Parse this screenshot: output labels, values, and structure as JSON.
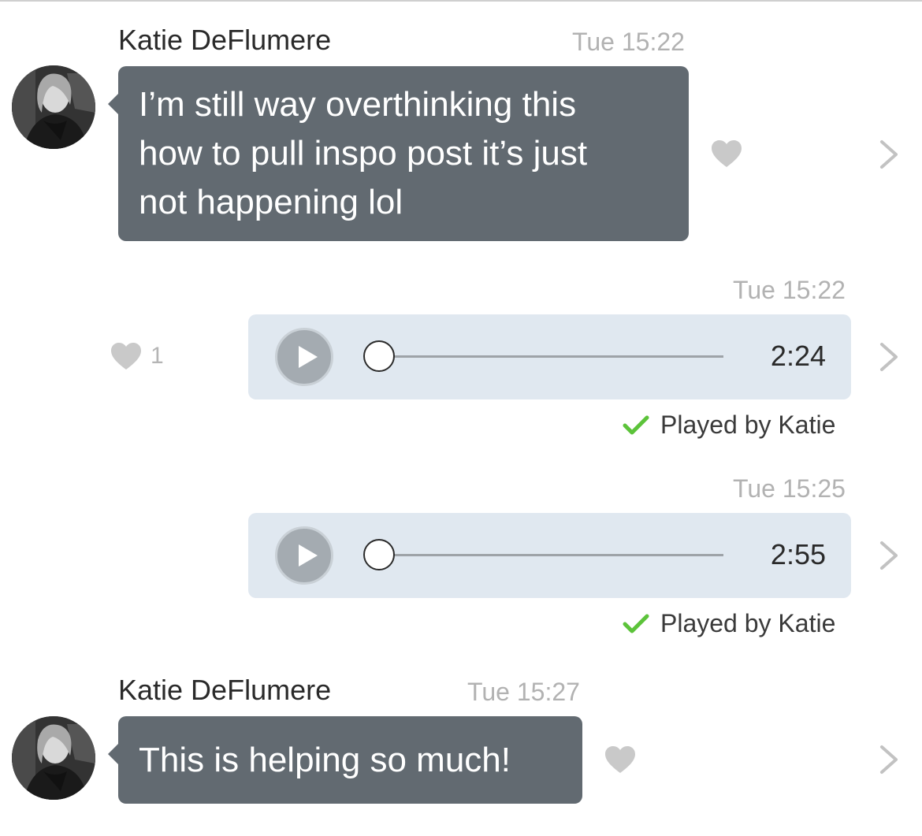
{
  "thread": {
    "message1": {
      "sender": "Katie DeFlumere",
      "time": "Tue 15:22",
      "lines": [
        "I’m still way overthinking this",
        "how to pull inspo post it’s just",
        "not happening lol"
      ],
      "heart_icon": "heart-icon",
      "chevron_icon": "chevron-right-icon"
    },
    "voice1": {
      "time": "Tue 15:22",
      "likes": "1",
      "duration": "2:24",
      "played_by": "Played by Katie",
      "progress": 0
    },
    "voice2": {
      "time": "Tue 15:25",
      "duration": "2:55",
      "played_by": "Played by Katie",
      "progress": 0
    },
    "message2": {
      "sender": "Katie DeFlumere",
      "time": "Tue 15:27",
      "text": "This is helping so much!"
    }
  },
  "colors": {
    "incoming_bubble": "#626a71",
    "audio_bubble": "#e0e8f0",
    "played_check": "#5cc33a",
    "heart": "#c9c9c9",
    "timestamp": "#b2b2b2"
  }
}
